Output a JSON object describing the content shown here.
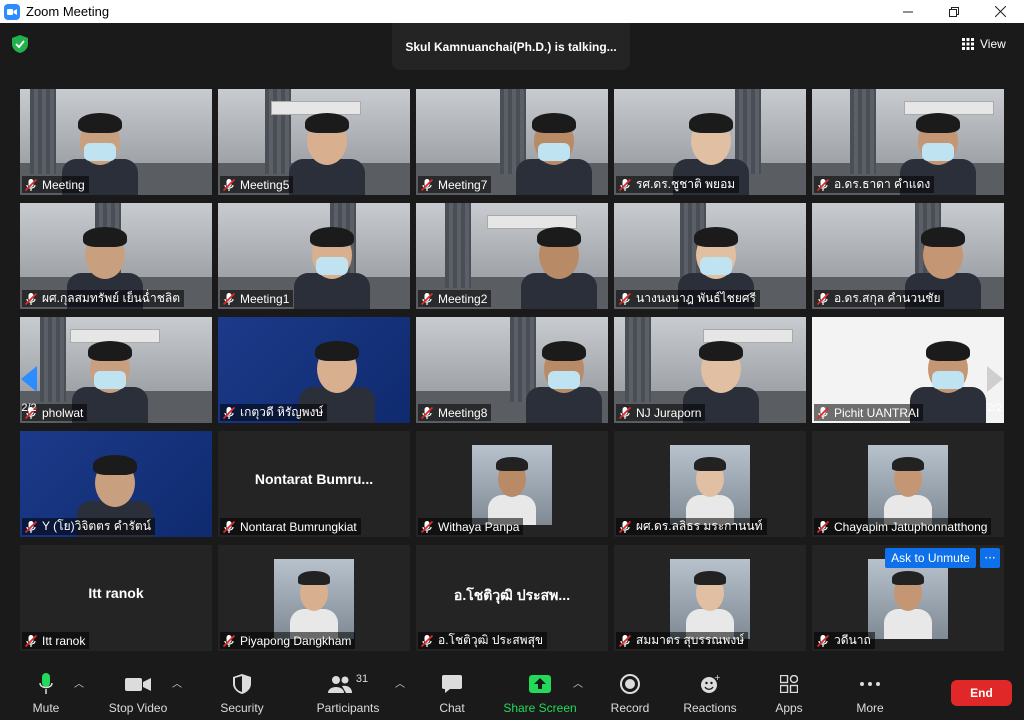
{
  "window": {
    "title": "Zoom Meeting"
  },
  "header": {
    "talking": "Skul Kamnuanchai(Ph.D.) is talking...",
    "view_label": "View"
  },
  "pagination": {
    "left": "2/2",
    "right": "2/2"
  },
  "tiles": [
    {
      "name": "Meeting",
      "video": true
    },
    {
      "name": "Meeting5",
      "video": true
    },
    {
      "name": "Meeting7",
      "video": true
    },
    {
      "name": "รศ.ดร.ชูชาติ  พยอม",
      "video": true
    },
    {
      "name": "อ.ดร.ธาดา  คำแดง",
      "video": true
    },
    {
      "name": "ผศ.กุลสมทรัพย์  เย็นฉ่ำชลิต",
      "video": true
    },
    {
      "name": "Meeting1",
      "video": true
    },
    {
      "name": "Meeting2",
      "video": true
    },
    {
      "name": "นางนงนาฎ  พันธ์ไชยศรี",
      "video": true
    },
    {
      "name": "อ.ดร.สกุล  คำนวนชัย",
      "video": true
    },
    {
      "name": "pholwat",
      "video": true
    },
    {
      "name": "เกตุวดี หิรัญพงษ์",
      "video": true
    },
    {
      "name": "Meeting8",
      "video": true
    },
    {
      "name": "NJ Juraporn",
      "video": true
    },
    {
      "name": "Pichit UANTRAI",
      "video": true
    },
    {
      "name": "Y (โย)วิจิตตร  คำรัตน์",
      "video": true
    },
    {
      "name": "Nontarat Bumrungkiat",
      "video": false,
      "display": "Nontarat  Bumru..."
    },
    {
      "name": "Withaya Panpa",
      "video": false,
      "avatar": true
    },
    {
      "name": "ผศ.ดร.ลลิธร มระกานนท์",
      "video": false,
      "avatar": true
    },
    {
      "name": "Chayapim Jatuphonnatthong",
      "video": false,
      "avatar": true
    },
    {
      "name": "Itt ranok",
      "video": false,
      "display": "Itt ranok"
    },
    {
      "name": "Piyapong Dangkham",
      "video": false,
      "avatar": true
    },
    {
      "name": "อ.โชติวุฒิ ประสพสุข",
      "video": false,
      "display": "อ.โชติวุฒิ ประสพ..."
    },
    {
      "name": "สมมาตร สุบรรณพงษ์",
      "video": false,
      "avatar": true
    },
    {
      "name": "วดีนาถ",
      "video": false,
      "avatar": true
    }
  ],
  "ask_unmute": {
    "label": "Ask to Unmute",
    "more": "···"
  },
  "toolbar": {
    "mute": "Mute",
    "stop_video": "Stop Video",
    "security": "Security",
    "participants": "Participants",
    "participants_count": "31",
    "chat": "Chat",
    "share_screen": "Share Screen",
    "record": "Record",
    "reactions": "Reactions",
    "apps": "Apps",
    "more": "More",
    "end": "End"
  },
  "colors": {
    "accent": "#0e71eb",
    "end": "#e02828",
    "share": "#23d959"
  }
}
